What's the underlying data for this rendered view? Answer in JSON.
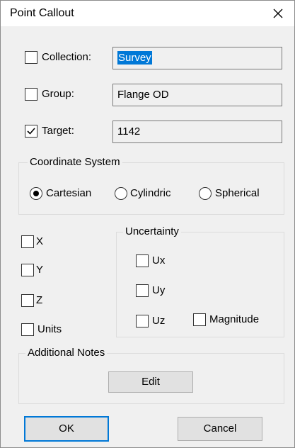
{
  "window": {
    "title": "Point Callout",
    "close_glyph": "×"
  },
  "fields": {
    "collection": {
      "label": "Collection:",
      "checked": false,
      "value": "Survey"
    },
    "group": {
      "label": "Group:",
      "checked": false,
      "value": "Flange OD"
    },
    "target": {
      "label": "Target:",
      "checked": true,
      "value": "1142"
    }
  },
  "coordinate_system": {
    "title": "Coordinate System",
    "options": [
      {
        "label": "Cartesian",
        "selected": true
      },
      {
        "label": "Cylindric",
        "selected": false
      },
      {
        "label": "Spherical",
        "selected": false
      }
    ]
  },
  "axes": {
    "x": "X",
    "y": "Y",
    "z": "Z",
    "units": "Units"
  },
  "uncertainty": {
    "title": "Uncertainty",
    "ux": "Ux",
    "uy": "Uy",
    "uz": "Uz",
    "magnitude": "Magnitude"
  },
  "notes": {
    "title": "Additional Notes",
    "edit_label": "Edit"
  },
  "buttons": {
    "ok": "OK",
    "cancel": "Cancel"
  },
  "colors": {
    "selection": "#0078d7",
    "default_button_border": "#0078d7",
    "background": "#f0f0f0"
  },
  "icons": {
    "close": "close-icon",
    "check": "checkmark-icon"
  }
}
